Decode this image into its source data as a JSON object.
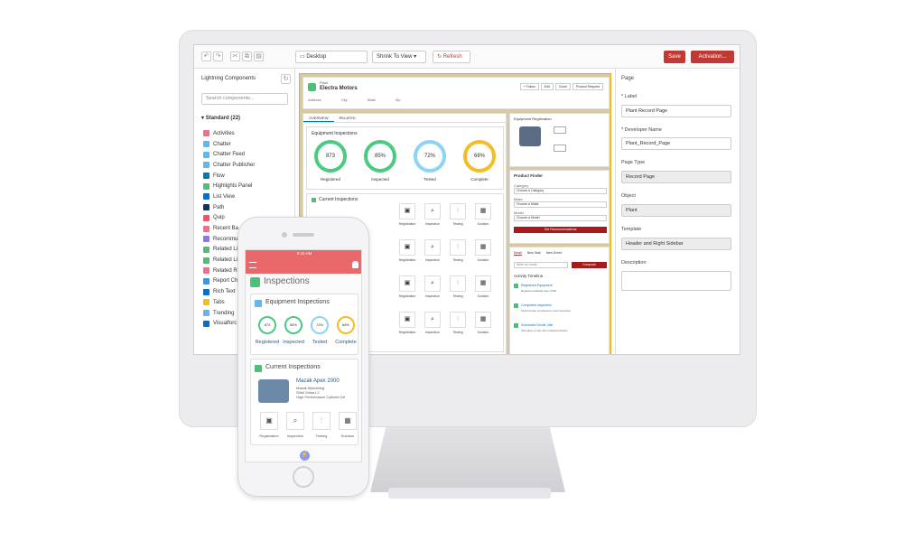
{
  "builder": {
    "toolbar": {
      "device": "Desktop",
      "view": "Shrink To View",
      "refresh": "Refresh",
      "save": "Save",
      "activation": "Activation..."
    },
    "left_panel": {
      "title": "Lightning Components",
      "search_placeholder": "Search components...",
      "section": "Standard (22)",
      "components": [
        {
          "label": "Activities",
          "color": "#eb7092"
        },
        {
          "label": "Chatter",
          "color": "#62b7ed"
        },
        {
          "label": "Chatter Feed",
          "color": "#62b7ed"
        },
        {
          "label": "Chatter Publisher",
          "color": "#62b7ed"
        },
        {
          "label": "Flow",
          "color": "#0079bc"
        },
        {
          "label": "Highlights Panel",
          "color": "#4bc076"
        },
        {
          "label": "List View",
          "color": "#0070d2"
        },
        {
          "label": "Path",
          "color": "#16325c"
        },
        {
          "label": "Quip",
          "color": "#f2536d"
        },
        {
          "label": "Recent Ba",
          "color": "#eb7092"
        },
        {
          "label": "Recommu",
          "color": "#8a76f0"
        },
        {
          "label": "Related Li",
          "color": "#4bc076"
        },
        {
          "label": "Related Li",
          "color": "#4bc076"
        },
        {
          "label": "Related R",
          "color": "#eb7092"
        },
        {
          "label": "Report Ch",
          "color": "#3c97dd"
        },
        {
          "label": "Rich Text",
          "color": "#0070d2"
        },
        {
          "label": "Tabs",
          "color": "#f4bc25"
        },
        {
          "label": "Trending",
          "color": "#62b7ed"
        },
        {
          "label": "Visualforc",
          "color": "#0070d2"
        }
      ]
    },
    "record": {
      "type": "Plant",
      "name": "Electra Motors",
      "actions": [
        "+ Follow",
        "Edit",
        "Clone",
        "Product Request"
      ],
      "fields": [
        "Address",
        "City",
        "State",
        "Zip"
      ],
      "tabs": [
        "OVERVIEW",
        "RELATED"
      ]
    },
    "equipment_inspections": {
      "title": "Equipment Inspections",
      "gauges": [
        {
          "value": "873",
          "label": "Registered",
          "color": "#4bca81"
        },
        {
          "value": "85%",
          "label": "Inspected",
          "color": "#4bca81"
        },
        {
          "value": "72%",
          "label": "Tested",
          "color": "#8cd3f5"
        },
        {
          "value": "68%",
          "label": "Complete",
          "color": "#f4bc25"
        }
      ]
    },
    "current_inspections": {
      "title": "Current Inspections",
      "actions": [
        "Registration",
        "Inspection",
        "Testing",
        "Solution"
      ]
    },
    "equipment_registration": "Equipment Registration",
    "product_finder": {
      "title": "Product Finder",
      "category_label": "Category",
      "category_value": "Choose a Category",
      "make_label": "Make",
      "make_value": "Choose a Make",
      "model_label": "Model",
      "model_value": "Choose a Model",
      "button": "Get Recommendations"
    },
    "activity": {
      "tabs": [
        "Email",
        "New Task",
        "New Event"
      ],
      "compose": "Write an email...",
      "compose_button": "Compose",
      "timeline_title": "Activity Timeline",
      "items": [
        {
          "title": "Registered Equipment",
          "sub": "Registered Mazak Apex 2000"
        },
        {
          "title": "Completed Inspection",
          "sub": "Todd Cooper completed a new inspection"
        },
        {
          "title": "Scheduled Onsite Visit",
          "sub": "Schedule on site visit to Electra Motors"
        }
      ]
    },
    "right_panel": {
      "section": "Page",
      "label_title": "* Label",
      "label_value": "Plant Record Page",
      "dev_title": "* Developer Name",
      "dev_value": "Plant_Record_Page",
      "type_title": "Page Type",
      "type_value": "Record Page",
      "object_title": "Object",
      "object_value": "Plant",
      "template_title": "Template",
      "template_value": "Header and Right Sidebar",
      "desc_title": "Description"
    }
  },
  "phone": {
    "time": "9:41 AM",
    "header": "Inspections",
    "equipment_title": "Equipment Inspections",
    "gauges": [
      {
        "value": "873",
        "label": "Registered",
        "color": "#4bca81"
      },
      {
        "value": "85%",
        "label": "Inspected",
        "color": "#4bca81"
      },
      {
        "value": "72%",
        "label": "Tested",
        "color": "#8cd3f5"
      },
      {
        "value": "68%",
        "label": "Complete",
        "color": "#f4bc25"
      }
    ],
    "current_title": "Current Inspections",
    "item_name": "Mazak Apex 2000",
    "item_lines": [
      "Mazak Machining",
      "Shell Xlrisa L2",
      "High Performance Cylinder Dri"
    ],
    "actions": [
      "Registration",
      "Inspection",
      "Testing",
      "Solution"
    ]
  }
}
